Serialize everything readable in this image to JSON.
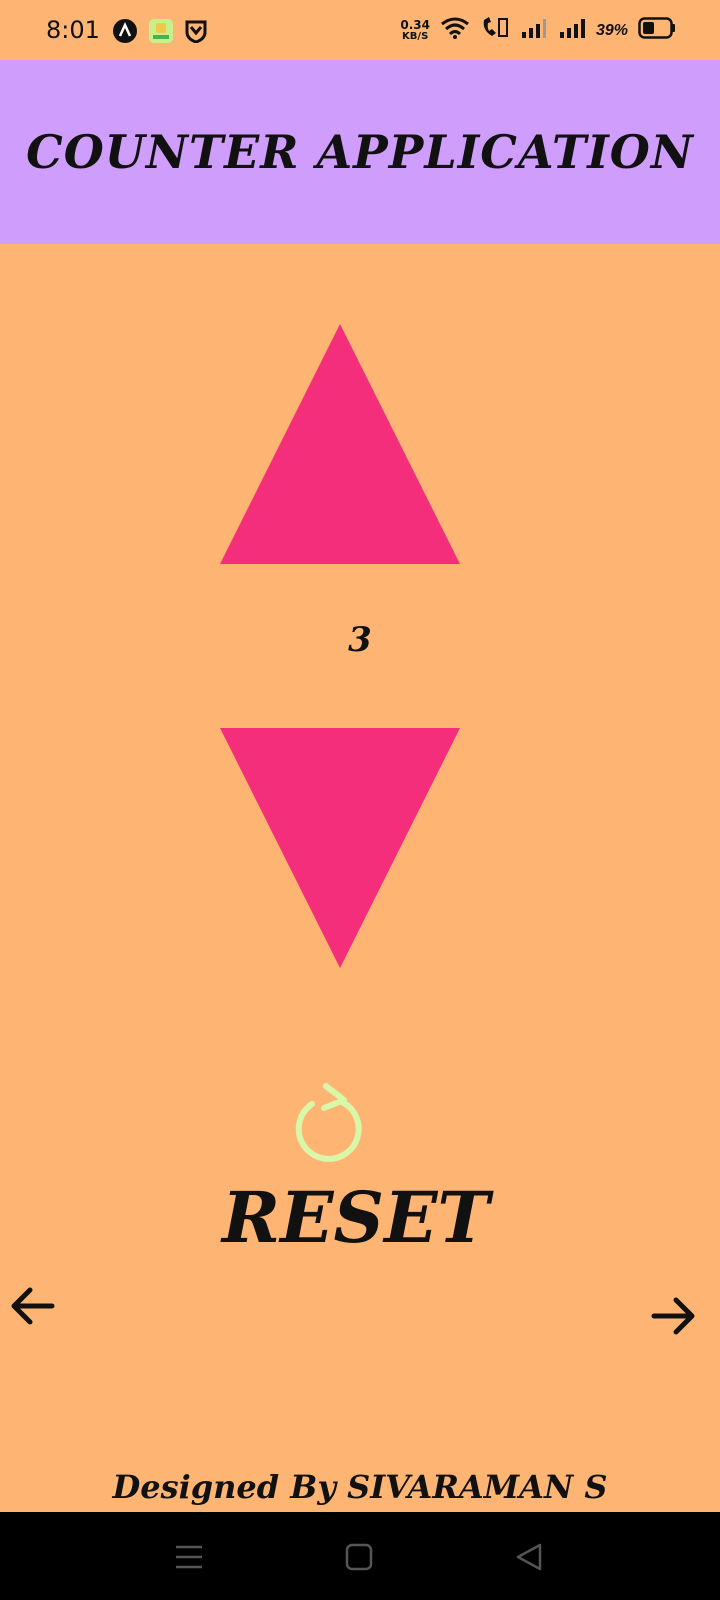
{
  "status_bar": {
    "time": "8:01",
    "net_speed_value": "0.34",
    "net_speed_unit": "KB/S",
    "battery_percent": "39%",
    "left_icons": [
      "app-a-icon",
      "app-tile-icon",
      "shield-icon"
    ],
    "right_icons": [
      "wifi-icon",
      "volte-icon",
      "signal-icon",
      "signal-icon",
      "battery-icon"
    ]
  },
  "header": {
    "title": "COUNTER APPLICATION",
    "background": "#CF9DFC"
  },
  "counter": {
    "value": "3",
    "increment_icon": "triangle-up-icon",
    "decrement_icon": "triangle-down-icon",
    "triangle_color": "#F42E7B"
  },
  "reset": {
    "label": "RESET",
    "icon": "refresh-icon",
    "icon_color": "#D9F7A8"
  },
  "navigation": {
    "prev_icon": "arrow-left-icon",
    "next_icon": "arrow-right-icon"
  },
  "footer": {
    "text": "Designed By SIVARAMAN S"
  },
  "system_nav": {
    "buttons": [
      "menu-icon",
      "home-icon",
      "back-icon"
    ]
  },
  "colors": {
    "background": "#FEB573",
    "text": "#111111"
  }
}
